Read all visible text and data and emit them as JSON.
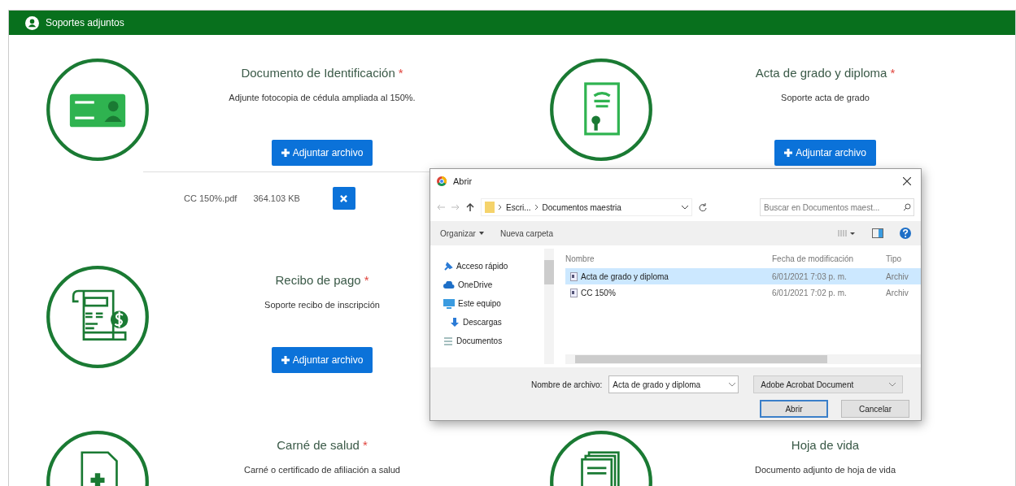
{
  "section": {
    "title": "Soportes adjuntos"
  },
  "rows": [
    {
      "cells": [
        {
          "kind": "id-card",
          "title": "Documento de Identificación",
          "required_mark": "*",
          "description": "Adjunte fotocopia de cédula ampliada al 150%.",
          "button": "Adjuntar archivo",
          "files": [
            {
              "name": "CC 150%.pdf",
              "size": "364.103 KB"
            }
          ]
        },
        {
          "kind": "diploma",
          "title": "Acta de grado y diploma",
          "required_mark": "*",
          "description": "Soporte acta de grado",
          "button": "Adjuntar archivo"
        }
      ]
    },
    {
      "cells": [
        {
          "kind": "receipt",
          "title": "Recibo de pago",
          "required_mark": "*",
          "description": "Soporte recibo de inscripción",
          "button": "Adjuntar archivo"
        }
      ]
    },
    {
      "cells": [
        {
          "kind": "health",
          "title": "Carné de salud",
          "required_mark": "*",
          "description": "Carné o certificado de afiliación a salud"
        },
        {
          "kind": "stack",
          "title": "Hoja de vida",
          "description": "Documento adjunto de hoja de vida"
        }
      ]
    }
  ],
  "dialog": {
    "title": "Abrir",
    "breadcrumb": [
      "Escri...",
      "Documentos maestria"
    ],
    "search": {
      "placeholder": "Buscar en Documentos maest..."
    },
    "toolbar": [
      "Organizar",
      "Nueva carpeta"
    ],
    "nav": [
      {
        "label": "Acceso rápido",
        "kind": "pin"
      },
      {
        "label": "OneDrive",
        "kind": "cloud"
      },
      {
        "label": "Este equipo",
        "kind": "monitor"
      },
      {
        "label": "Descargas",
        "kind": "download"
      },
      {
        "label": "Documentos",
        "kind": "docs"
      }
    ],
    "columns": [
      "Nombre",
      "Fecha de modificación",
      "Tipo"
    ],
    "files": [
      {
        "name": "Acta de grado y diploma",
        "date": "6/01/2021 7:03 p. m.",
        "type": "Archiv",
        "selected": true
      },
      {
        "name": "CC 150%",
        "date": "6/01/2021 7:02 p. m.",
        "type": "Archiv",
        "selected": false
      }
    ],
    "filename_label": "Nombre de archivo:",
    "filename": "Acta de grado y diploma",
    "filetype": "Adobe Acrobat Document",
    "buttons": [
      {
        "label": "Abrir",
        "default": true
      },
      {
        "label": "Cancelar",
        "default": false
      }
    ]
  }
}
